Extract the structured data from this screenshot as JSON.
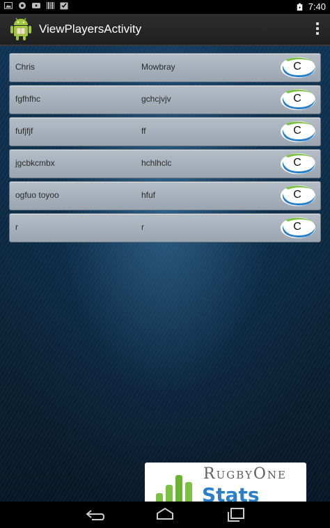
{
  "status_bar": {
    "time": "7:40",
    "icons_left": [
      "picture-icon",
      "app-icon",
      "youtube-icon",
      "barcode-icon",
      "checkbox-icon"
    ],
    "icons_right": [
      "battery-charging-icon"
    ]
  },
  "action_bar": {
    "title": "ViewPlayersActivity"
  },
  "players": [
    {
      "first": "Chris",
      "last": "Mowbray",
      "button": "C"
    },
    {
      "first": "fgfhfhc",
      "last": "gchcjvjv",
      "button": "C"
    },
    {
      "first": "fufjfjf",
      "last": "ff",
      "button": "C"
    },
    {
      "first": "jgcbkcmbx",
      "last": "hchlhclc",
      "button": "C"
    },
    {
      "first": "ogfuo toyoo",
      "last": "hfuf",
      "button": "C"
    },
    {
      "first": "r",
      "last": "r",
      "button": "C"
    }
  ],
  "logo": {
    "line1": "RugbyOne",
    "line2": "Stats"
  },
  "colors": {
    "accent": "#2a7fc9",
    "row_bg": "#a7b1bb",
    "logo_green": "#7cc144"
  }
}
